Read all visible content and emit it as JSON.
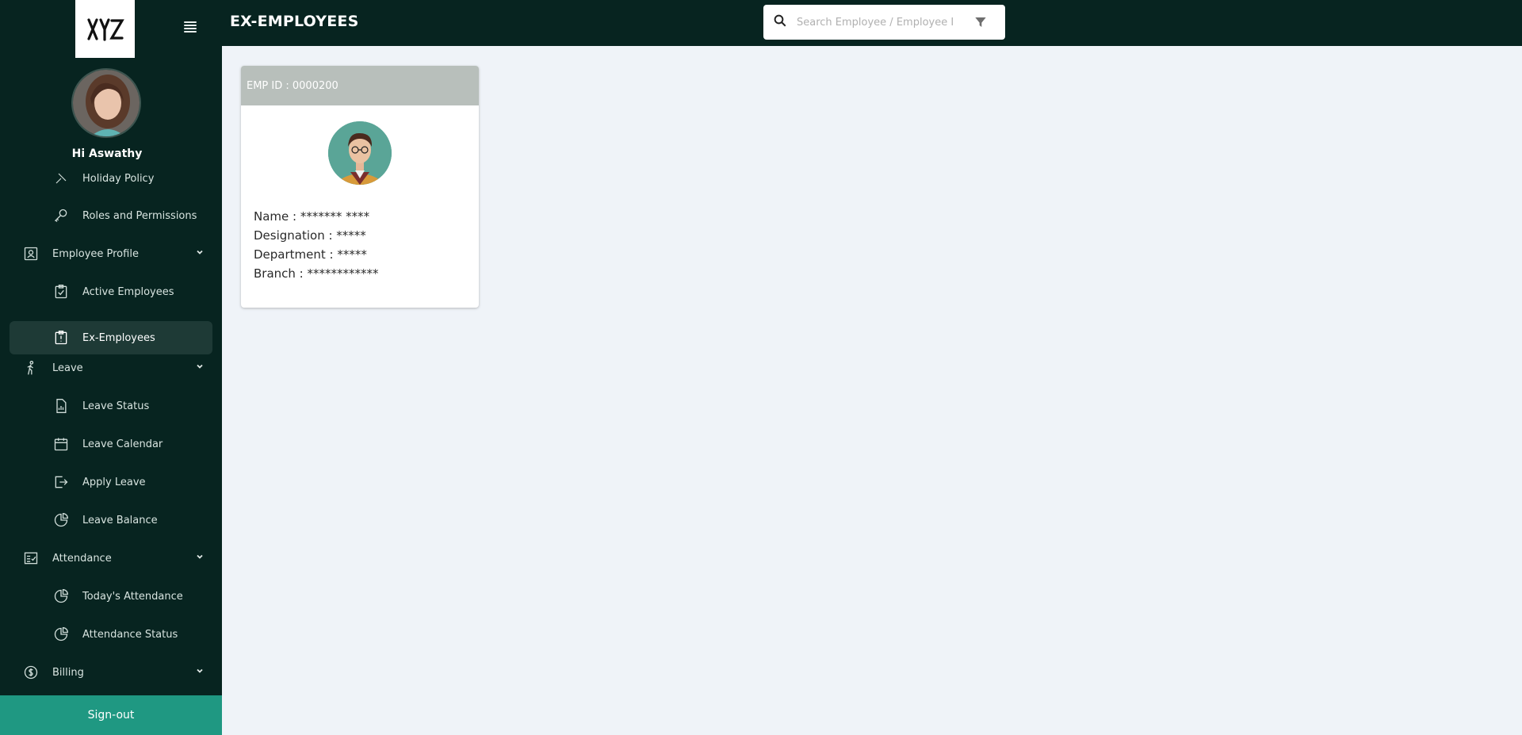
{
  "app": {
    "logo_text": "XYZ"
  },
  "user": {
    "greeting": "Hi Aswathy"
  },
  "header": {
    "title": "EX-EMPLOYEES",
    "search_placeholder": "Search Employee / Employee I"
  },
  "sidebar": {
    "partial_item": "Holiday Policy",
    "items": [
      {
        "label": "Roles and Permissions",
        "icon": "key-icon"
      },
      {
        "label": "Employee Profile",
        "icon": "profile-card-icon"
      },
      {
        "label": "Active Employees",
        "icon": "clipboard-check-icon"
      },
      {
        "label": "Ex-Employees",
        "icon": "clipboard-alert-icon"
      },
      {
        "label": "Leave",
        "icon": "walking-icon"
      },
      {
        "label": "Leave Status",
        "icon": "report-icon"
      },
      {
        "label": "Leave Calendar",
        "icon": "calendar-icon"
      },
      {
        "label": "Apply Leave",
        "icon": "logout-arrow-icon"
      },
      {
        "label": "Leave Balance",
        "icon": "pie-chart-icon"
      },
      {
        "label": "Attendance",
        "icon": "checklist-icon"
      },
      {
        "label": "Today's Attendance",
        "icon": "pie-chart-icon"
      },
      {
        "label": "Attendance Status",
        "icon": "pie-chart-icon"
      },
      {
        "label": "Billing",
        "icon": "dollar-circle-icon"
      }
    ],
    "signout_label": "Sign-out"
  },
  "card": {
    "emp_id": "EMP ID : 0000200",
    "name": "Name : ******* ****",
    "designation": "Designation : *****",
    "department": "Department : *****",
    "branch": "Branch : ************"
  },
  "colors": {
    "sidebar_bg": "#072420",
    "accent": "#1f9882",
    "card_header": "#b8bfbb",
    "content_bg": "#eff3f8"
  }
}
